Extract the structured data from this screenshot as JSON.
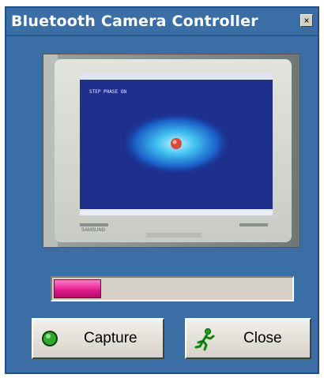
{
  "window": {
    "title": "Bluetooth Camera Controller",
    "close_glyph": "×"
  },
  "preview": {
    "screen_text": "STEP PHASE ON",
    "monitor_brand": "SAMSUNG"
  },
  "progress": {
    "value_fraction": 0.2,
    "fill_color": "#e0188a"
  },
  "buttons": {
    "capture": {
      "label": "Capture",
      "icon": "green-circle-icon"
    },
    "close": {
      "label": "Close",
      "icon": "running-man-icon"
    }
  },
  "colors": {
    "window_bg": "#3a6ea5",
    "button_face": "#d4d0c8"
  }
}
